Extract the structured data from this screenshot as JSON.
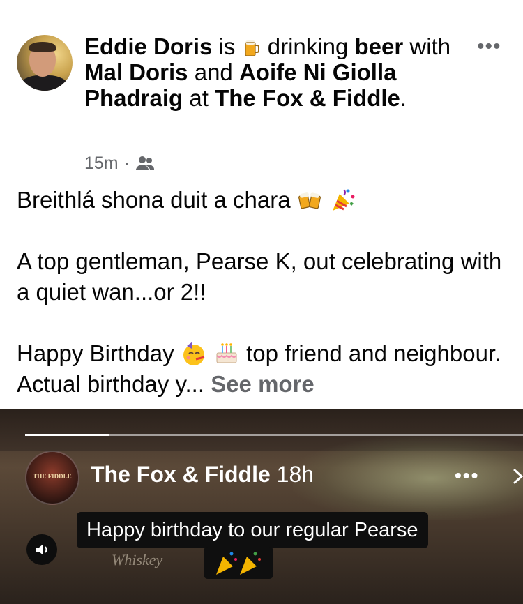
{
  "post": {
    "author": "Eddie Doris",
    "verb_is": "is",
    "activity": "drinking",
    "object": "beer",
    "with_word": "with",
    "friend1": "Mal Doris",
    "and_word": "and",
    "friend2": "Aoife Ni Giolla Phadraig",
    "at_word": "at",
    "place": "The Fox & Fiddle",
    "period": ".",
    "time": "15m",
    "audience_icon": "friends-icon",
    "more_icon": "more-options-icon",
    "line1": "Breithlá shona duit a chara",
    "line2": "A top gentleman, Pearse K, out celebrating with a quiet wan...or 2!!",
    "line3a": "Happy Birthday",
    "line3b": "top friend and neighbour. Actual birthday y...",
    "see_more": "See more"
  },
  "shared_story": {
    "page_name": "The Fox & Fiddle",
    "time": "18h",
    "avatar_text": "THE FIDDLE",
    "caption": "Happy birthday to our regular Pearse",
    "background_sign": "Whiskey"
  }
}
